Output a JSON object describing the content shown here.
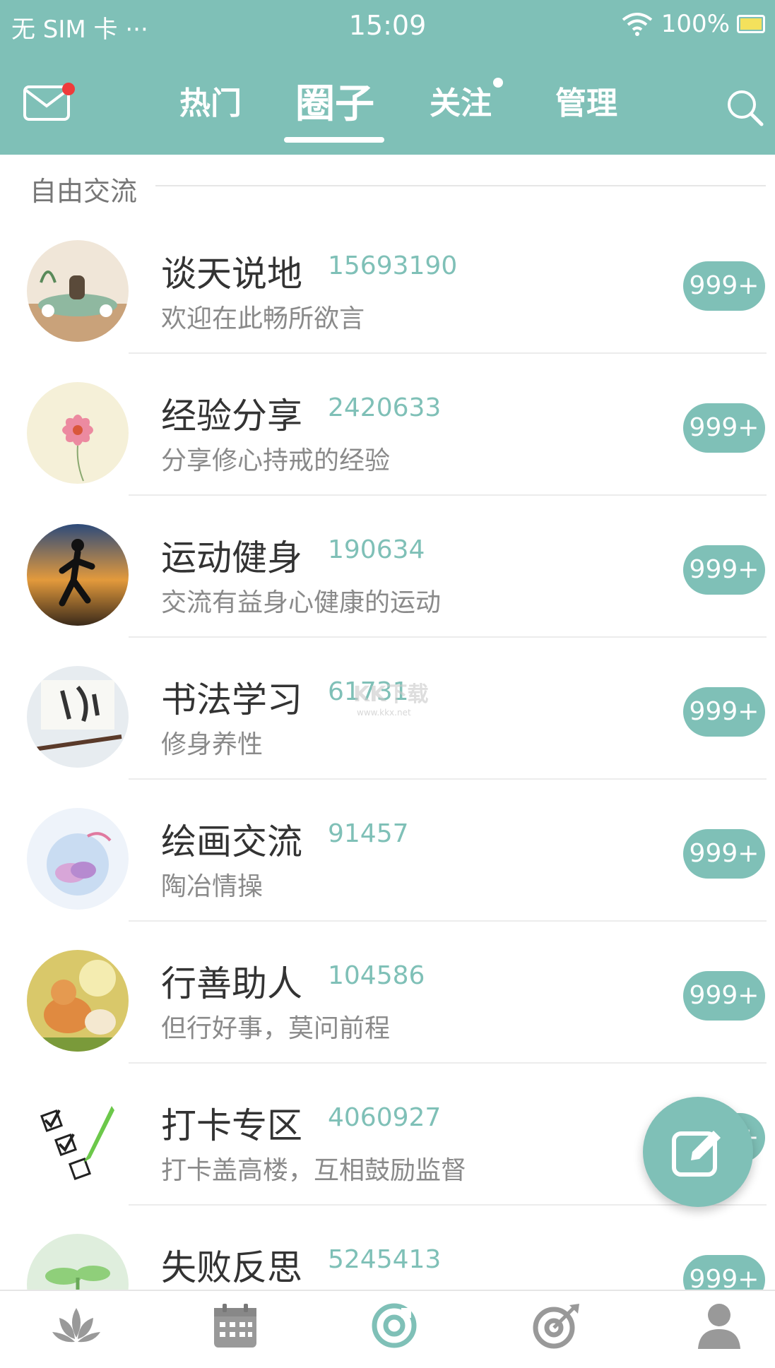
{
  "status_bar": {
    "carrier": "无 SIM 卡 ···",
    "time": "15:09",
    "battery": "100%"
  },
  "top_nav": {
    "tabs": [
      {
        "label": "热门",
        "active": false
      },
      {
        "label": "圈子",
        "active": true
      },
      {
        "label": "关注",
        "active": false,
        "has_dot": true
      },
      {
        "label": "管理",
        "active": false
      }
    ],
    "mail_has_notification": true
  },
  "section": {
    "label": "自由交流"
  },
  "circles": [
    {
      "title": "谈天说地",
      "count": "15693190",
      "description": "欢迎在此畅所欲言",
      "badge": "999+"
    },
    {
      "title": "经验分享",
      "count": "2420633",
      "description": "分享修心持戒的经验",
      "badge": "999+"
    },
    {
      "title": "运动健身",
      "count": "190634",
      "description": "交流有益身心健康的运动",
      "badge": "999+"
    },
    {
      "title": "书法学习",
      "count": "61731",
      "description": "修身养性",
      "badge": "999+"
    },
    {
      "title": "绘画交流",
      "count": "91457",
      "description": "陶冶情操",
      "badge": "999+"
    },
    {
      "title": "行善助人",
      "count": "104586",
      "description": "但行好事，莫问前程",
      "badge": "999+"
    },
    {
      "title": "打卡专区",
      "count": "4060927",
      "description": "打卡盖高楼，互相鼓励监督",
      "badge": "999+"
    },
    {
      "title": "失败反思",
      "count": "5245413",
      "description": "",
      "badge": "999+"
    }
  ],
  "watermark": {
    "text": "KK下载",
    "url_text": "www.kkx.net"
  },
  "bottom_nav": {
    "items": [
      {
        "icon": "lotus-icon",
        "label": "",
        "active": false
      },
      {
        "icon": "calendar-icon",
        "label": "",
        "active": false
      },
      {
        "icon": "circle-icon",
        "label": "",
        "active": true
      },
      {
        "icon": "target-icon",
        "label": "",
        "active": false
      },
      {
        "icon": "person-icon",
        "label": "",
        "active": false
      }
    ]
  },
  "colors": {
    "accent": "#7fc0b7",
    "badge_text": "#ffffff",
    "notification": "#ef3b3b"
  }
}
